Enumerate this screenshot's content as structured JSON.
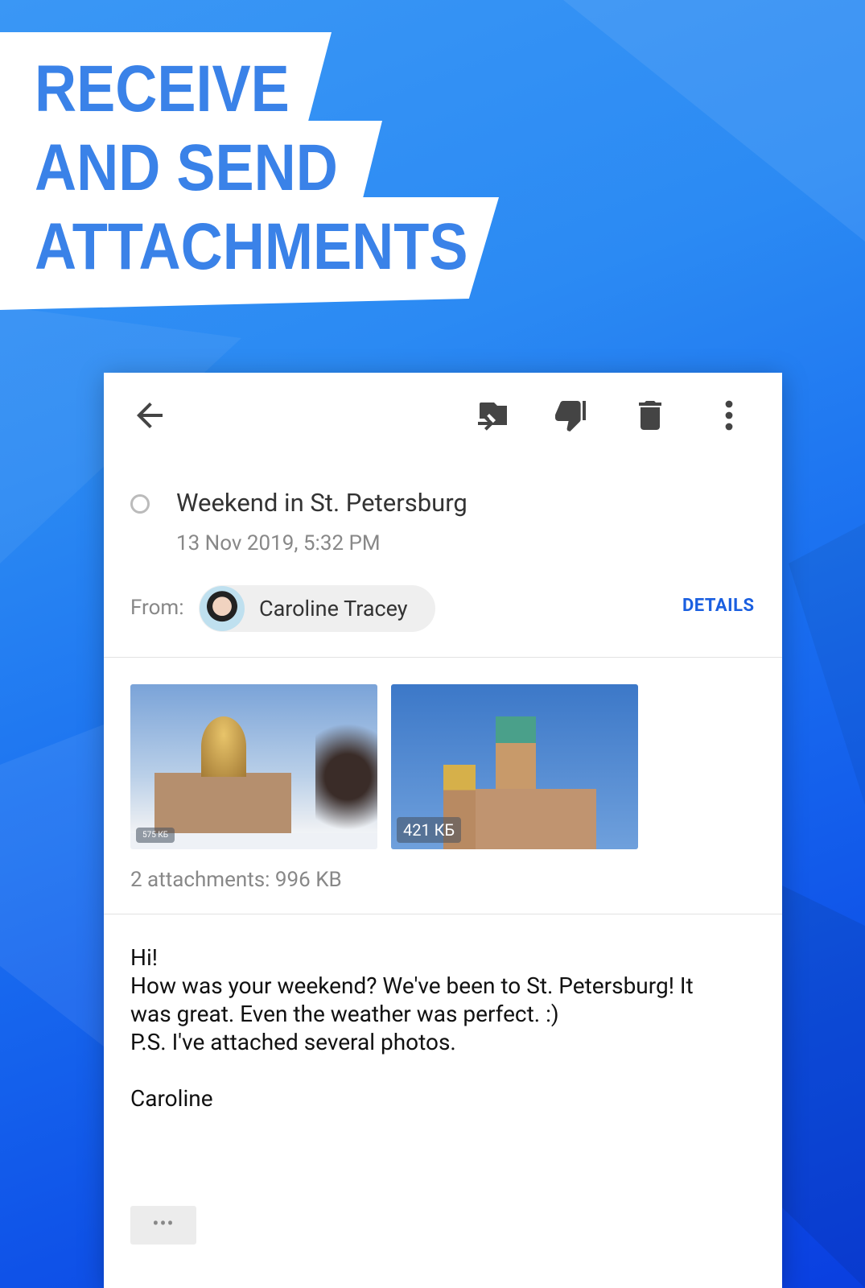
{
  "headline": {
    "line1": "RECEIVE",
    "line2": "AND SEND",
    "line3": "ATTACHMENTS"
  },
  "toolbar": {
    "icons": [
      "arrow-back-icon",
      "move-to-folder-icon",
      "thumbs-down-icon",
      "trash-icon",
      "more-vert-icon"
    ]
  },
  "email": {
    "subject": "Weekend in St. Petersburg",
    "date": "13 Nov 2019, 5:32 PM",
    "from_label": "From:",
    "sender": "Caroline Tracey",
    "details_label": "DETAILS",
    "attachments": [
      {
        "size": "575 КБ"
      },
      {
        "size": "421 КБ"
      }
    ],
    "attachments_summary": "2 attachments: 996 KB",
    "body": "Hi!\nHow was your weekend? We've been to St. Petersburg! It was great. Even the weather was perfect. :)\nP.S. I've attached several photos.\n\nCaroline",
    "more_label": "•••"
  },
  "colors": {
    "accent": "#1a5fe0",
    "headline": "#3a82e8"
  }
}
